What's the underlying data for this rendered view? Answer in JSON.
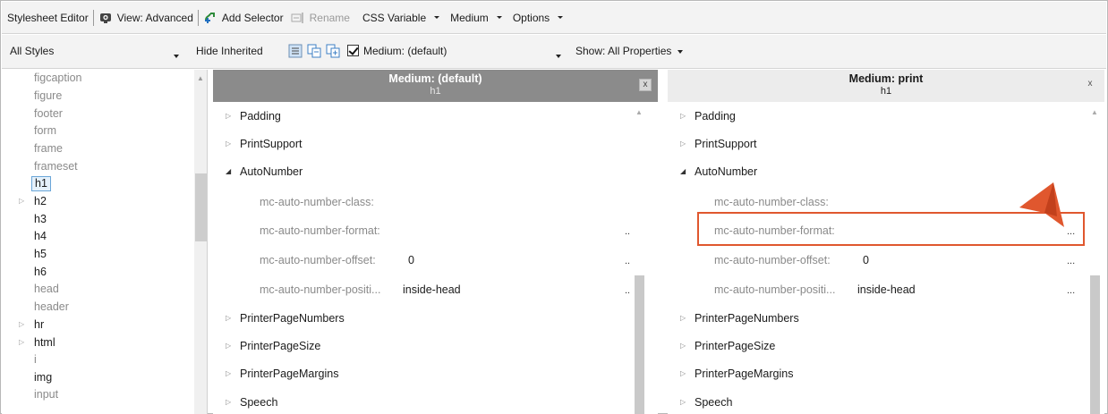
{
  "toolbar": {
    "title": "Stylesheet Editor",
    "view": "View: Advanced",
    "add_selector": "Add Selector",
    "rename": "Rename",
    "css_variable": "CSS Variable",
    "medium": "Medium",
    "options": "Options"
  },
  "filter_bar": {
    "styles_select": "All Styles",
    "hide_inherited": "Hide Inherited",
    "medium_checkbox": "Medium: (default)",
    "show": "Show: All Properties"
  },
  "selectors": [
    {
      "label": "figcaption",
      "gray": true
    },
    {
      "label": "figure",
      "gray": true
    },
    {
      "label": "footer",
      "gray": true
    },
    {
      "label": "form",
      "gray": true
    },
    {
      "label": "frame",
      "gray": true
    },
    {
      "label": "frameset",
      "gray": true
    },
    {
      "label": "h1",
      "selected": true
    },
    {
      "label": "h2",
      "expandable": true
    },
    {
      "label": "h3"
    },
    {
      "label": "h4"
    },
    {
      "label": "h5"
    },
    {
      "label": "h6"
    },
    {
      "label": "head",
      "gray": true
    },
    {
      "label": "header",
      "gray": true
    },
    {
      "label": "hr",
      "expandable": true
    },
    {
      "label": "html",
      "expandable": true
    },
    {
      "label": "i",
      "gray": true
    },
    {
      "label": "img"
    },
    {
      "label": "input",
      "gray": true
    }
  ],
  "panels": [
    {
      "title": "Medium: (default)",
      "subtitle": "h1",
      "close": "x",
      "groups": [
        "Padding",
        "PrintSupport",
        "AutoNumber",
        "PrinterPageNumbers",
        "PrinterPageSize",
        "PrinterPageMargins",
        "Speech"
      ],
      "props": [
        {
          "name": "mc-auto-number-class:",
          "value": "",
          "dots": ""
        },
        {
          "name": "mc-auto-number-format:",
          "value": "",
          "dots": "..."
        },
        {
          "name": "mc-auto-number-offset:",
          "value": "0",
          "dots": "..."
        },
        {
          "name": "mc-auto-number-positi...",
          "value": "inside-head",
          "dots": "..."
        }
      ]
    },
    {
      "title": "Medium: print",
      "subtitle": "h1",
      "close": "x",
      "groups": [
        "Padding",
        "PrintSupport",
        "AutoNumber",
        "PrinterPageNumbers",
        "PrinterPageSize",
        "PrinterPageMargins",
        "Speech"
      ],
      "props": [
        {
          "name": "mc-auto-number-class:",
          "value": "",
          "dots": ""
        },
        {
          "name": "mc-auto-number-format:",
          "value": "",
          "dots": "..."
        },
        {
          "name": "mc-auto-number-offset:",
          "value": "0",
          "dots": "..."
        },
        {
          "name": "mc-auto-number-positi...",
          "value": "inside-head",
          "dots": "..."
        }
      ]
    }
  ],
  "colors": {
    "highlight": "#e0572e",
    "selected_bg": "#e5f1fb",
    "header_default": "#8b8b8b"
  }
}
